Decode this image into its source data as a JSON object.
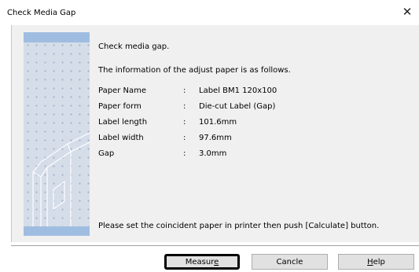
{
  "window": {
    "title": "Check Media Gap",
    "close_glyph": "✕"
  },
  "content": {
    "heading": "Check media gap.",
    "intro": "The information of the adjust paper is as follows.",
    "rows": [
      {
        "label": "Paper Name",
        "colon": ":",
        "value": "Label BM1 120x100"
      },
      {
        "label": "Paper form",
        "colon": ":",
        "value": "Die-cut Label (Gap)"
      },
      {
        "label": "Label length",
        "colon": ":",
        "value": "101.6mm"
      },
      {
        "label": "Label width",
        "colon": ":",
        "value": "97.6mm"
      },
      {
        "label": "Gap",
        "colon": ":",
        "value": "3.0mm"
      }
    ],
    "instruction": "Please set the coincident paper in printer then push [Calculate] button."
  },
  "buttons": {
    "measure_prefix": "Measur",
    "measure_accel": "e",
    "cancle": "Cancle",
    "help_accel": "H",
    "help_rest": "elp"
  },
  "colors": {
    "panel": "#f0f0f0",
    "image_bar": "#9fbde0",
    "image_bg": "#d5dde9"
  }
}
